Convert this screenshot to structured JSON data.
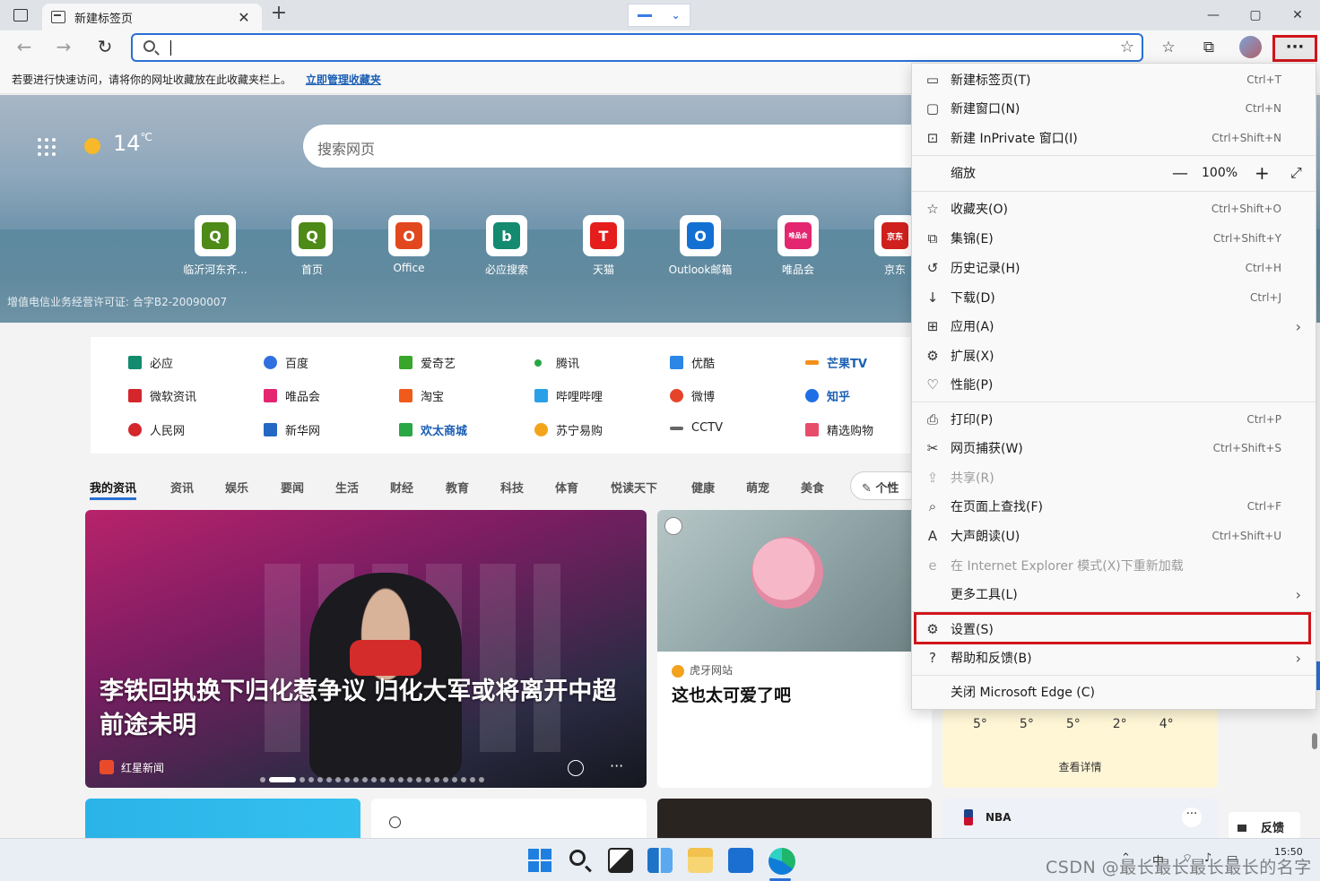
{
  "browser": {
    "tab_title": "新建标签页",
    "tab_close": "✕",
    "new_tab": "+",
    "window_controls": {
      "minimize": "—",
      "maximize": "▢",
      "close": "✕"
    },
    "nav": {
      "back": "←",
      "forward": "→",
      "refresh": "↻"
    },
    "address_value": "",
    "more_label": "···",
    "favorites_notice": "若要进行快速访问，请将你的网址收藏放在此收藏夹栏上。",
    "favorites_link": "立即管理收藏夹"
  },
  "hero": {
    "temperature": "14",
    "temp_unit": "℃",
    "search_placeholder": "搜索网页",
    "license": "增值电信业务经营许可证: 合字B2-20090007",
    "quick_links": [
      {
        "label": "临沂河东齐...",
        "glyph": "Q",
        "color": "#4e8a17"
      },
      {
        "label": "首页",
        "glyph": "Q",
        "color": "#4e8a17"
      },
      {
        "label": "Office",
        "glyph": "O",
        "color": "#e2481e"
      },
      {
        "label": "必应搜索",
        "glyph": "b",
        "color": "#148a6f"
      },
      {
        "label": "天猫",
        "glyph": "T",
        "color": "#e51d1d"
      },
      {
        "label": "Outlook邮箱",
        "glyph": "O",
        "color": "#1370d3"
      },
      {
        "label": "唯品会",
        "glyph": "唯品会",
        "color": "#e3266f"
      },
      {
        "label": "京东",
        "glyph": "京东",
        "color": "#d0201e"
      }
    ]
  },
  "sites": [
    {
      "label": "必应",
      "color": "#148a6f",
      "bold": false
    },
    {
      "label": "百度",
      "color": "#2f6fe0",
      "bold": false
    },
    {
      "label": "爱奇艺",
      "color": "#38a62b",
      "bold": false
    },
    {
      "label": "腾讯",
      "color": "#2aa745",
      "bold": false
    },
    {
      "label": "优酷",
      "color": "#2c86e6",
      "bold": false
    },
    {
      "label": "芒果TV",
      "color": "#f29019",
      "bold": true
    },
    {
      "label": "微软资讯",
      "color": "#d4262b",
      "bold": false
    },
    {
      "label": "唯品会",
      "color": "#e3266f",
      "bold": false
    },
    {
      "label": "淘宝",
      "color": "#f05a1a",
      "bold": false
    },
    {
      "label": "哔哩哔哩",
      "color": "#2aa1e6",
      "bold": false
    },
    {
      "label": "微博",
      "color": "#e6432b",
      "bold": false
    },
    {
      "label": "知乎",
      "color": "#1e6fe6",
      "bold": true
    },
    {
      "label": "人民网",
      "color": "#d4262b",
      "bold": false
    },
    {
      "label": "新华网",
      "color": "#2468c4",
      "bold": false
    },
    {
      "label": "欢太商城",
      "color": "#2aa745",
      "bold": true
    },
    {
      "label": "苏宁易购",
      "color": "#f2a51b",
      "bold": false
    },
    {
      "label": "CCTV",
      "color": "#666666",
      "bold": false
    },
    {
      "label": "精选购物",
      "color": "#e84c6b",
      "bold": false
    }
  ],
  "news_tabs": [
    "我的资讯",
    "资讯",
    "娱乐",
    "要闻",
    "生活",
    "财经",
    "教育",
    "科技",
    "体育",
    "悦读天下",
    "健康",
    "萌宠",
    "美食"
  ],
  "personalize_label": "个性",
  "cards": {
    "main_headline": "李铁回执换下归化惹争议 归化大军或将离开中超前途未明",
    "main_source": "红星新闻",
    "main_more": "···",
    "card2_source": "虎牙网站",
    "card2_title": "这也太可爱了吧",
    "weather_temps": [
      "5°",
      "5°",
      "5°",
      "2°",
      "4°"
    ],
    "weather_detail": "查看详情",
    "nba_label": "NBA",
    "nba_more": "···",
    "feedback_label": "反馈"
  },
  "menu": {
    "items": [
      {
        "icon": "▭",
        "label": "新建标签页(T)",
        "shortcut": "Ctrl+T"
      },
      {
        "icon": "▢",
        "label": "新建窗口(N)",
        "shortcut": "Ctrl+N"
      },
      {
        "icon": "⊡",
        "label": "新建 InPrivate 窗口(I)",
        "shortcut": "Ctrl+Shift+N"
      },
      {
        "icon": "",
        "label": "缩放",
        "shortcut": ""
      },
      {
        "icon": "☆",
        "label": "收藏夹(O)",
        "shortcut": "Ctrl+Shift+O"
      },
      {
        "icon": "⧉",
        "label": "集锦(E)",
        "shortcut": "Ctrl+Shift+Y"
      },
      {
        "icon": "↺",
        "label": "历史记录(H)",
        "shortcut": "Ctrl+H"
      },
      {
        "icon": "↓",
        "label": "下载(D)",
        "shortcut": "Ctrl+J"
      },
      {
        "icon": "⊞",
        "label": "应用(A)",
        "shortcut": ""
      },
      {
        "icon": "⚙",
        "label": "扩展(X)",
        "shortcut": ""
      },
      {
        "icon": "♡",
        "label": "性能(P)",
        "shortcut": ""
      },
      {
        "icon": "⎙",
        "label": "打印(P)",
        "shortcut": "Ctrl+P"
      },
      {
        "icon": "✂",
        "label": "网页捕获(W)",
        "shortcut": "Ctrl+Shift+S"
      },
      {
        "icon": "⇪",
        "label": "共享(R)",
        "shortcut": ""
      },
      {
        "icon": "⌕",
        "label": "在页面上查找(F)",
        "shortcut": "Ctrl+F"
      },
      {
        "icon": "A",
        "label": "大声朗读(U)",
        "shortcut": "Ctrl+Shift+U"
      },
      {
        "icon": "e",
        "label": "在 Internet Explorer 模式(X)下重新加载",
        "shortcut": ""
      },
      {
        "icon": "",
        "label": "更多工具(L)",
        "shortcut": ""
      },
      {
        "icon": "⚙",
        "label": "设置(S)",
        "shortcut": ""
      },
      {
        "icon": "?",
        "label": "帮助和反馈(B)",
        "shortcut": ""
      },
      {
        "icon": "",
        "label": "关闭 Microsoft Edge (C)",
        "shortcut": ""
      }
    ],
    "zoom_value": "100%",
    "zoom_minus": "—",
    "zoom_plus": "+",
    "zoom_full": "⤢",
    "arrow": "›"
  },
  "taskbar": {
    "time": "15:50",
    "watermark": "CSDN @最长最长最长最长的名字"
  }
}
